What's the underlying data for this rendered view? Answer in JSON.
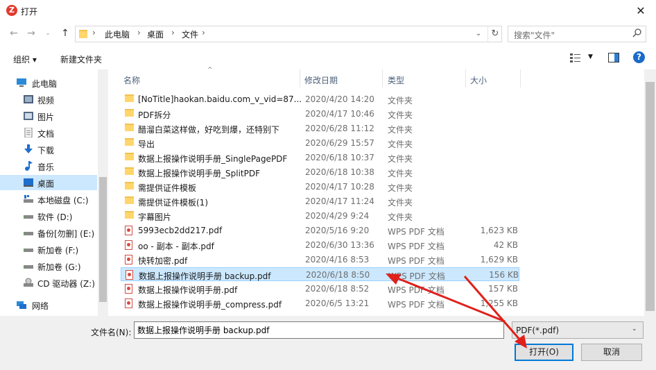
{
  "window": {
    "title": "打开",
    "app_icon_letter": "Z"
  },
  "address": {
    "breadcrumbs": [
      "此电脑",
      "桌面",
      "文件"
    ]
  },
  "search": {
    "placeholder": "搜索\"文件\""
  },
  "toolbar": {
    "organize": "组织 ▾",
    "new_folder": "新建文件夹"
  },
  "sidebar": {
    "items": [
      {
        "label": "此电脑",
        "icon": "computer-icon"
      },
      {
        "label": "视频",
        "icon": "video-icon"
      },
      {
        "label": "图片",
        "icon": "picture-icon"
      },
      {
        "label": "文档",
        "icon": "document-icon"
      },
      {
        "label": "下载",
        "icon": "download-icon"
      },
      {
        "label": "音乐",
        "icon": "music-icon"
      },
      {
        "label": "桌面",
        "icon": "desktop-icon",
        "selected": true
      },
      {
        "label": "本地磁盘 (C:)",
        "icon": "drive-icon"
      },
      {
        "label": "软件 (D:)",
        "icon": "drive-icon"
      },
      {
        "label": "备份[勿删] (E:)",
        "icon": "drive-icon"
      },
      {
        "label": "新加卷 (F:)",
        "icon": "drive-icon"
      },
      {
        "label": "新加卷 (G:)",
        "icon": "drive-icon"
      },
      {
        "label": "CD 驱动器 (Z:)",
        "icon": "cd-drive-icon"
      },
      {
        "label": "网络",
        "icon": "network-icon"
      }
    ]
  },
  "columns": {
    "name": "名称",
    "date": "修改日期",
    "type": "类型",
    "size": "大小"
  },
  "files": [
    {
      "name": "[NoTitle]haokan.baidu.com_v_vid=87...",
      "date": "2020/4/20 14:20",
      "type": "文件夹",
      "size": "",
      "kind": "folder"
    },
    {
      "name": "PDF拆分",
      "date": "2020/4/17 10:46",
      "type": "文件夹",
      "size": "",
      "kind": "folder"
    },
    {
      "name": "醋溜白菜这样做，好吃到爆，还特别下",
      "date": "2020/6/28 11:12",
      "type": "文件夹",
      "size": "",
      "kind": "folder"
    },
    {
      "name": "导出",
      "date": "2020/6/29 15:57",
      "type": "文件夹",
      "size": "",
      "kind": "folder"
    },
    {
      "name": "数据上报操作说明手册_SinglePagePDF",
      "date": "2020/6/18 10:37",
      "type": "文件夹",
      "size": "",
      "kind": "folder"
    },
    {
      "name": "数据上报操作说明手册_SplitPDF",
      "date": "2020/6/18 10:38",
      "type": "文件夹",
      "size": "",
      "kind": "folder"
    },
    {
      "name": "需提供证件模板",
      "date": "2020/4/17 10:28",
      "type": "文件夹",
      "size": "",
      "kind": "folder"
    },
    {
      "name": "需提供证件模板(1)",
      "date": "2020/4/17 11:24",
      "type": "文件夹",
      "size": "",
      "kind": "folder"
    },
    {
      "name": "字幕图片",
      "date": "2020/4/29 9:24",
      "type": "文件夹",
      "size": "",
      "kind": "folder"
    },
    {
      "name": "5993ecb2dd217.pdf",
      "date": "2020/5/16 9:20",
      "type": "WPS PDF 文档",
      "size": "1,623 KB",
      "kind": "pdf"
    },
    {
      "name": "oo - 副本 - 副本.pdf",
      "date": "2020/6/30 13:36",
      "type": "WPS PDF 文档",
      "size": "42 KB",
      "kind": "pdf"
    },
    {
      "name": "快转加密.pdf",
      "date": "2020/4/16 8:53",
      "type": "WPS PDF 文档",
      "size": "1,629 KB",
      "kind": "pdf"
    },
    {
      "name": "数据上报操作说明手册 backup.pdf",
      "date": "2020/6/18 8:50",
      "type": "WPS PDF 文档",
      "size": "156 KB",
      "kind": "pdf",
      "selected": true
    },
    {
      "name": "数据上报操作说明手册.pdf",
      "date": "2020/6/18 8:52",
      "type": "WPS PDF 文档",
      "size": "157 KB",
      "kind": "pdf"
    },
    {
      "name": "数据上报操作说明手册_compress.pdf",
      "date": "2020/6/5 13:21",
      "type": "WPS PDF 文档",
      "size": "1,255 KB",
      "kind": "pdf"
    }
  ],
  "filename": {
    "label": "文件名(N):",
    "value": "数据上报操作说明手册 backup.pdf"
  },
  "filter": {
    "value": "PDF(*.pdf)"
  },
  "buttons": {
    "open": "打开(O)",
    "cancel": "取消"
  },
  "colors": {
    "selection": "#cce8ff",
    "accent": "#0078d7",
    "annotation_arrow": "#e0201a"
  }
}
